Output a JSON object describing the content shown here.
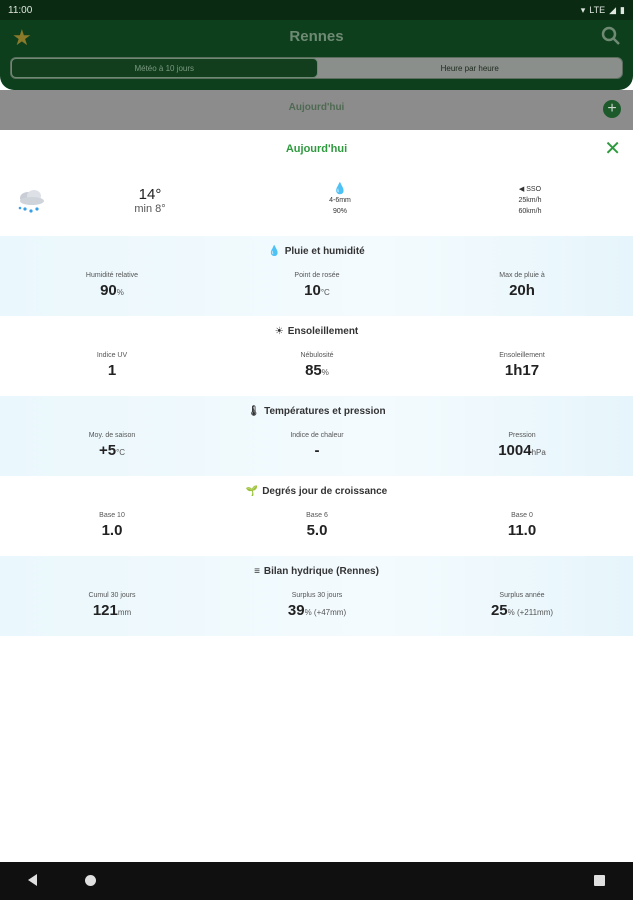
{
  "status": {
    "time": "11:00",
    "network": "LTE"
  },
  "app": {
    "city": "Rennes",
    "tabs": [
      "Météo à 10 jours",
      "Heure par heure"
    ],
    "day_label": "Aujourd'hui"
  },
  "sheet": {
    "title": "Aujourd'hui",
    "summary": {
      "temp": "14°",
      "min": "min 8°",
      "rain_amount": "4-6mm",
      "rain_prob": "90%",
      "wind_dir": "SSO",
      "wind_speed": "25km/h",
      "wind_gust": "60km/h"
    },
    "sections": [
      {
        "icon": "💧",
        "title": "Pluie et humidité",
        "items": [
          {
            "label": "Humidité relative",
            "value": "90",
            "unit": "%"
          },
          {
            "label": "Point de rosée",
            "value": "10",
            "unit": "°C"
          },
          {
            "label": "Max de pluie à",
            "value": "20h",
            "unit": ""
          }
        ]
      },
      {
        "icon": "☀",
        "title": "Ensoleillement",
        "items": [
          {
            "label": "Indice UV",
            "value": "1",
            "unit": ""
          },
          {
            "label": "Nébulosité",
            "value": "85",
            "unit": "%"
          },
          {
            "label": "Ensoleillement",
            "value": "1h17",
            "unit": ""
          }
        ]
      },
      {
        "icon": "🌡",
        "title": "Températures et pression",
        "items": [
          {
            "label": "Moy. de saison",
            "value": "+5",
            "unit": "°C"
          },
          {
            "label": "Indice de chaleur",
            "value": "-",
            "unit": ""
          },
          {
            "label": "Pression",
            "value": "1004",
            "unit": "hPa"
          }
        ]
      },
      {
        "icon": "🌱",
        "title": "Degrés jour de croissance",
        "items": [
          {
            "label": "Base 10",
            "value": "1.0",
            "unit": ""
          },
          {
            "label": "Base 6",
            "value": "5.0",
            "unit": ""
          },
          {
            "label": "Base 0",
            "value": "11.0",
            "unit": ""
          }
        ]
      },
      {
        "icon": "≡",
        "title": "Bilan hydrique (Rennes)",
        "items": [
          {
            "label": "Cumul 30 jours",
            "value": "121",
            "unit": "mm"
          },
          {
            "label": "Surplus 30 jours",
            "value": "39",
            "unit": "% (+47mm)"
          },
          {
            "label": "Surplus année",
            "value": "25",
            "unit": "% (+211mm)"
          }
        ]
      }
    ]
  }
}
